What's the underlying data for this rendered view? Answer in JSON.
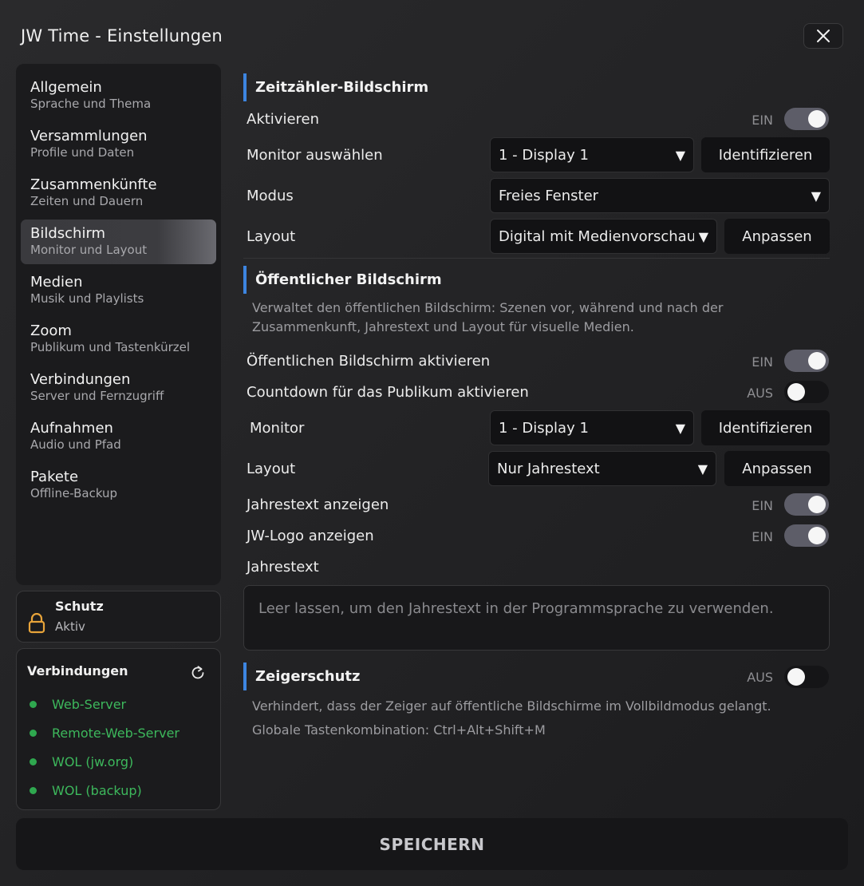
{
  "window": {
    "title": "JW Time - Einstellungen"
  },
  "sidebar": {
    "items": [
      {
        "label": "Allgemein",
        "sub": "Sprache und Thema"
      },
      {
        "label": "Versammlungen",
        "sub": "Profile und Daten"
      },
      {
        "label": "Zusammenkünfte",
        "sub": "Zeiten und Dauern"
      },
      {
        "label": "Bildschirm",
        "sub": "Monitor und Layout"
      },
      {
        "label": "Medien",
        "sub": "Musik und Playlists"
      },
      {
        "label": "Zoom",
        "sub": "Publikum und Tastenkürzel"
      },
      {
        "label": "Verbindungen",
        "sub": "Server und Fernzugriff"
      },
      {
        "label": "Aufnahmen",
        "sub": "Audio und Pfad"
      },
      {
        "label": "Pakete",
        "sub": "Offline-Backup"
      }
    ],
    "active_index": 3
  },
  "protection": {
    "title": "Schutz",
    "status": "Aktiv"
  },
  "connections": {
    "title": "Verbindungen",
    "items": [
      "Web-Server",
      "Remote-Web-Server",
      "WOL (jw.org)",
      "WOL (backup)"
    ],
    "status_color": "#2fa84f"
  },
  "timer": {
    "title": "Zeitzähler-Bildschirm",
    "activate_label": "Aktivieren",
    "activate_state": "EIN",
    "monitor_label": "Monitor auswählen",
    "monitor_value": "1 - Display 1",
    "identify_label": "Identifizieren",
    "mode_label": "Modus",
    "mode_value": "Freies Fenster",
    "layout_label": "Layout",
    "layout_value": "Digital mit Medienvorschau",
    "adjust_label": "Anpassen"
  },
  "public": {
    "title": "Öffentlicher Bildschirm",
    "description": "Verwaltet den öffentlichen Bildschirm: Szenen vor, während und nach der Zusammenkunft, Jahrestext und Layout für visuelle Medien.",
    "enable_label": "Öffentlichen Bildschirm aktivieren",
    "enable_state": "EIN",
    "countdown_label": "Countdown für das Publikum aktivieren",
    "countdown_state": "AUS",
    "monitor_label": "Monitor",
    "monitor_value": "1 - Display 1",
    "identify_label": "Identifizieren",
    "layout_label": "Layout",
    "layout_value": "Nur Jahrestext",
    "adjust_label": "Anpassen",
    "yeartext_show_label": "Jahrestext anzeigen",
    "yeartext_show_state": "EIN",
    "logo_label": "JW-Logo anzeigen",
    "logo_state": "EIN",
    "yeartext_label": "Jahrestext",
    "yeartext_placeholder": "Leer lassen, um den Jahrestext in der Programmsprache zu verwenden."
  },
  "pointer": {
    "title": "Zeigerschutz",
    "state": "AUS",
    "description": "Verhindert, dass der Zeiger auf öffentliche Bildschirme im Vollbildmodus gelangt.",
    "shortcut": "Globale Tastenkombination: Ctrl+Alt+Shift+M"
  },
  "footer": {
    "save_label": "SPEICHERN"
  },
  "colors": {
    "accent": "#3d85e0",
    "toggle_on": "#5d5d68",
    "connected": "#3db85c"
  },
  "icons": {
    "close": "close-icon",
    "lock": "lock-icon",
    "refresh": "refresh-icon",
    "caret": "caret-down-icon"
  }
}
